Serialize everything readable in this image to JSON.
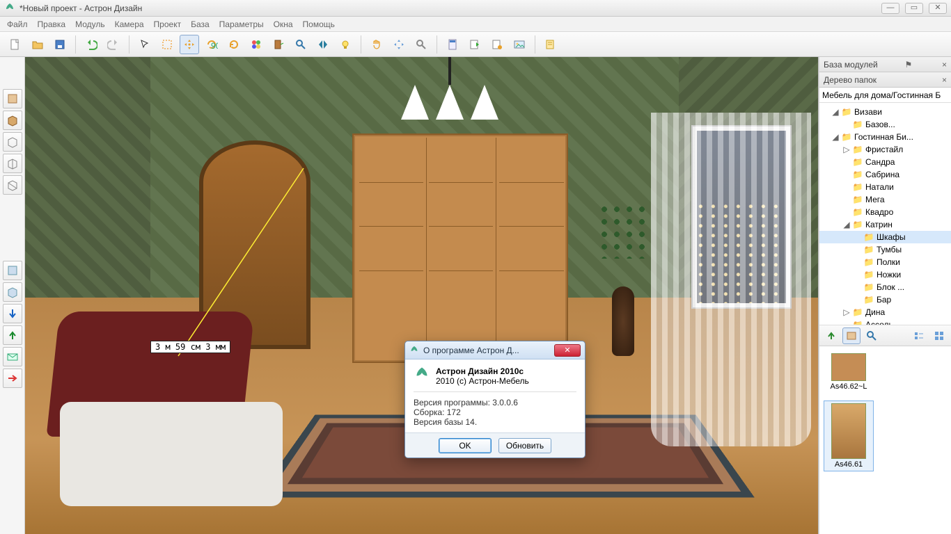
{
  "window": {
    "title": "*Новый проект - Астрон Дизайн"
  },
  "menu": {
    "file": "Файл",
    "edit": "Правка",
    "module": "Модуль",
    "camera": "Камера",
    "project": "Проект",
    "base": "База",
    "params": "Параметры",
    "windows": "Окна",
    "help": "Помощь"
  },
  "measurement": "3 м 59 см 3 мм",
  "about_dialog": {
    "title": "О программе Астрон Д...",
    "product": "Астрон Дизайн 2010с",
    "copyright": "2010 (с) Астрон-Мебель",
    "version_label": "Версия программы: 3.0.0.6",
    "build_label": "Сборка: 172",
    "base_label": "Версия базы 14.",
    "ok": "OK",
    "update": "Обновить"
  },
  "sidebar": {
    "panel_title": "База модулей",
    "tree_title": "Дерево папок",
    "path": "Мебель для дома/Гостинная Б",
    "tree": {
      "n0": "Визави",
      "n0a": "Базов...",
      "n1": "Гостинная Би...",
      "n2": "Фристайл",
      "n3": "Сандра",
      "n4": "Сабрина",
      "n5": "Натали",
      "n6": "Мега",
      "n7": "Квадро",
      "n8": "Катрин",
      "n8a": "Шкафы",
      "n8b": "Тумбы",
      "n8c": "Полки",
      "n8d": "Ножки",
      "n8e": "Блок ...",
      "n8f": "Бар",
      "n9": "Дина",
      "n10": "Ассоль"
    }
  },
  "thumbs": {
    "a": "As46.62~L",
    "b": "As46.61"
  }
}
